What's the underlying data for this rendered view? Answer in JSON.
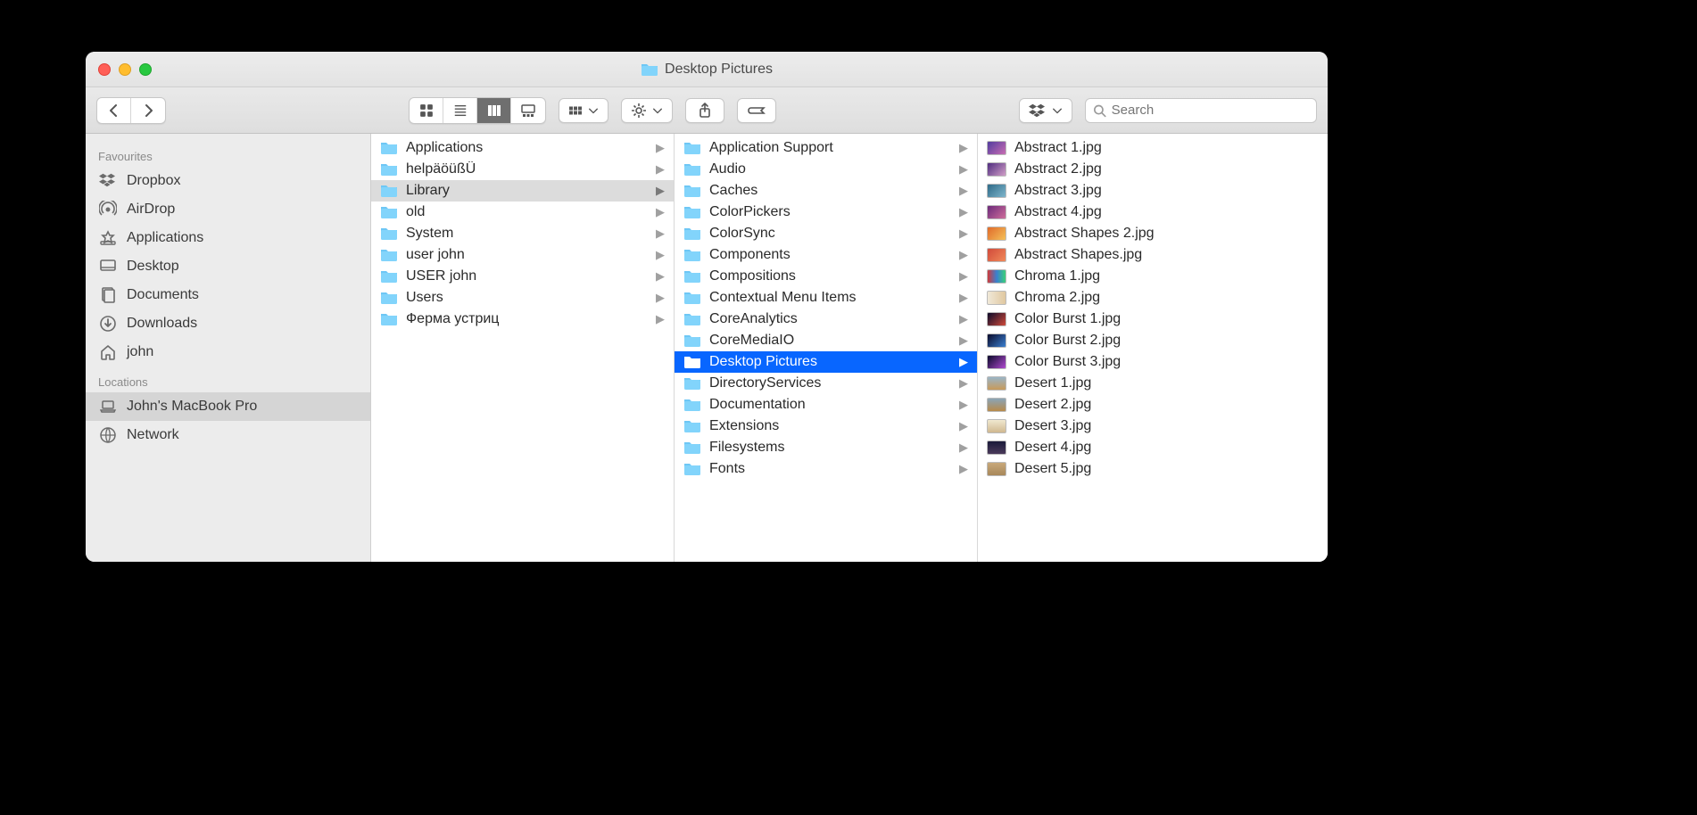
{
  "window": {
    "title": "Desktop Pictures"
  },
  "toolbar": {
    "search_placeholder": "Search"
  },
  "sidebar": {
    "groups": [
      {
        "label": "Favourites",
        "items": [
          {
            "icon": "dropbox",
            "label": "Dropbox"
          },
          {
            "icon": "airdrop",
            "label": "AirDrop"
          },
          {
            "icon": "applications",
            "label": "Applications"
          },
          {
            "icon": "desktop",
            "label": "Desktop"
          },
          {
            "icon": "documents",
            "label": "Documents"
          },
          {
            "icon": "downloads",
            "label": "Downloads"
          },
          {
            "icon": "home",
            "label": "john"
          }
        ]
      },
      {
        "label": "Locations",
        "items": [
          {
            "icon": "laptop",
            "label": "John's MacBook Pro",
            "selected": true
          },
          {
            "icon": "network",
            "label": "Network"
          }
        ]
      }
    ]
  },
  "columns": [
    {
      "items": [
        {
          "type": "folder",
          "label": "Applications",
          "hasChildren": true
        },
        {
          "type": "folder",
          "label": "helpäöüßÜ",
          "hasChildren": true
        },
        {
          "type": "folder",
          "label": "Library",
          "hasChildren": true,
          "selected": "grey"
        },
        {
          "type": "folder",
          "label": "old",
          "hasChildren": true
        },
        {
          "type": "folder",
          "label": "System",
          "hasChildren": true
        },
        {
          "type": "folder",
          "label": "user john",
          "hasChildren": true
        },
        {
          "type": "folder",
          "label": "USER john",
          "hasChildren": true
        },
        {
          "type": "folder",
          "label": "Users",
          "hasChildren": true
        },
        {
          "type": "folder",
          "label": "Ферма устриц",
          "hasChildren": true
        }
      ]
    },
    {
      "items": [
        {
          "type": "folder",
          "label": "Application Support",
          "hasChildren": true
        },
        {
          "type": "folder",
          "label": "Audio",
          "hasChildren": true
        },
        {
          "type": "folder",
          "label": "Caches",
          "hasChildren": true
        },
        {
          "type": "folder",
          "label": "ColorPickers",
          "hasChildren": true
        },
        {
          "type": "folder",
          "label": "ColorSync",
          "hasChildren": true
        },
        {
          "type": "folder",
          "label": "Components",
          "hasChildren": true
        },
        {
          "type": "folder",
          "label": "Compositions",
          "hasChildren": true
        },
        {
          "type": "folder",
          "label": "Contextual Menu Items",
          "hasChildren": true
        },
        {
          "type": "folder",
          "label": "CoreAnalytics",
          "hasChildren": true
        },
        {
          "type": "folder",
          "label": "CoreMediaIO",
          "hasChildren": true
        },
        {
          "type": "folder",
          "label": "Desktop Pictures",
          "hasChildren": true,
          "selected": "blue"
        },
        {
          "type": "folder",
          "label": "DirectoryServices",
          "hasChildren": true
        },
        {
          "type": "folder",
          "label": "Documentation",
          "hasChildren": true
        },
        {
          "type": "folder",
          "label": "Extensions",
          "hasChildren": true
        },
        {
          "type": "folder",
          "label": "Filesystems",
          "hasChildren": true
        },
        {
          "type": "folder",
          "label": "Fonts",
          "hasChildren": true
        }
      ]
    },
    {
      "items": [
        {
          "type": "image",
          "label": "Abstract 1.jpg",
          "thumb": "linear-gradient(135deg,#513c9e,#c96eb3)"
        },
        {
          "type": "image",
          "label": "Abstract 2.jpg",
          "thumb": "linear-gradient(135deg,#4f2d7f,#d29fc8)"
        },
        {
          "type": "image",
          "label": "Abstract 3.jpg",
          "thumb": "linear-gradient(135deg,#2e6a88,#7fb6cc)"
        },
        {
          "type": "image",
          "label": "Abstract 4.jpg",
          "thumb": "linear-gradient(135deg,#6b2a7a,#cf6e9c)"
        },
        {
          "type": "image",
          "label": "Abstract Shapes 2.jpg",
          "thumb": "linear-gradient(135deg,#e06a2a,#f4c15a)"
        },
        {
          "type": "image",
          "label": "Abstract Shapes.jpg",
          "thumb": "linear-gradient(135deg,#d14a3a,#f08a5a)"
        },
        {
          "type": "image",
          "label": "Chroma 1.jpg",
          "thumb": "linear-gradient(90deg,#d03a3a,#3a7fd0,#3ad07a)"
        },
        {
          "type": "image",
          "label": "Chroma 2.jpg",
          "thumb": "linear-gradient(90deg,#f0e8d8,#e0c8a0)"
        },
        {
          "type": "image",
          "label": "Color Burst 1.jpg",
          "thumb": "linear-gradient(135deg,#0a0a2a,#d04a3a)"
        },
        {
          "type": "image",
          "label": "Color Burst 2.jpg",
          "thumb": "linear-gradient(135deg,#0a0a2a,#3a7fd0)"
        },
        {
          "type": "image",
          "label": "Color Burst 3.jpg",
          "thumb": "linear-gradient(135deg,#0a0a2a,#b04ad0)"
        },
        {
          "type": "image",
          "label": "Desert 1.jpg",
          "thumb": "linear-gradient(180deg,#9ab5c8,#c89a5a)"
        },
        {
          "type": "image",
          "label": "Desert 2.jpg",
          "thumb": "linear-gradient(180deg,#8aa5b8,#b88a4a)"
        },
        {
          "type": "image",
          "label": "Desert 3.jpg",
          "thumb": "linear-gradient(180deg,#f0e8d0,#d0b890)"
        },
        {
          "type": "image",
          "label": "Desert 4.jpg",
          "thumb": "linear-gradient(180deg,#1a1a3a,#4a3a5a)"
        },
        {
          "type": "image",
          "label": "Desert 5.jpg",
          "thumb": "linear-gradient(180deg,#c8a87a,#a8885a)"
        }
      ]
    }
  ]
}
